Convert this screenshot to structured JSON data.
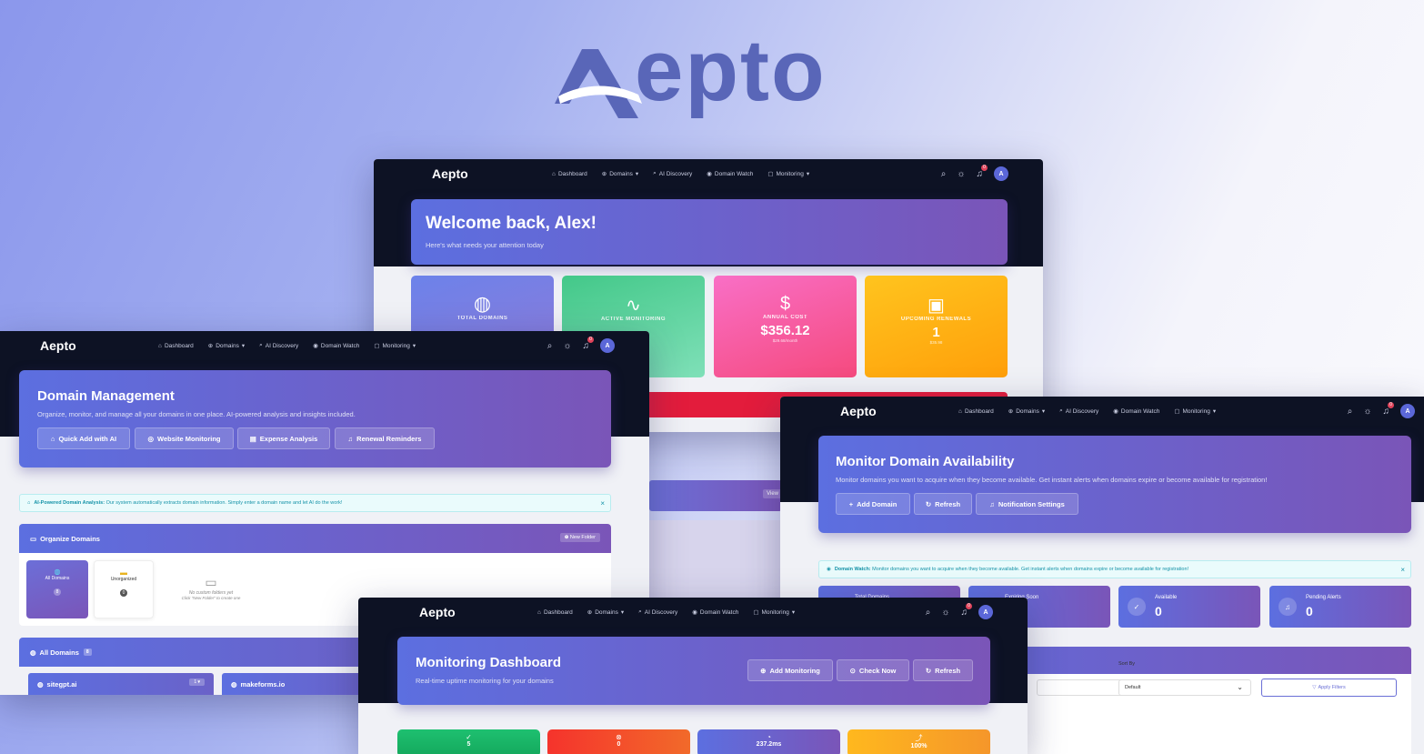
{
  "brand": {
    "logo_text": "epto",
    "full": "Aepto",
    "accent": "#5966b8"
  },
  "nav": {
    "brand": "Aepto",
    "links": [
      "Dashboard",
      "Domains",
      "AI Discovery",
      "Domain Watch",
      "Monitoring"
    ],
    "avatar": "A",
    "badge": "0"
  },
  "dashboard": {
    "title": "Welcome back, Alex!",
    "subtitle": "Here's what needs your attention today",
    "cards": [
      {
        "label": "TOTAL DOMAINS",
        "value": "",
        "sub": "",
        "color": "#6b7fe6"
      },
      {
        "label": "ACTIVE MONITORING",
        "value": "",
        "sub": "",
        "color": "#4bcf8e"
      },
      {
        "label": "ANNUAL COST",
        "value": "$356.12",
        "sub": "$29.68/month",
        "color": "#f6529b"
      },
      {
        "label": "UPCOMING RENEWALS",
        "value": "1",
        "sub": "$35.98",
        "color": "#ffb20a"
      }
    ]
  },
  "domain_mgmt": {
    "title": "Domain Management",
    "subtitle": "Organize, monitor, and manage all your domains in one place. AI-powered analysis and insights included.",
    "buttons": [
      "Quick Add with AI",
      "Website Monitoring",
      "Expense Analysis",
      "Renewal Reminders"
    ],
    "info_strong": "AI-Powered Domain Analysis:",
    "info_text": "Our system automatically extracts domain information. Simply enter a domain name and let AI do the work!",
    "organize_title": "Organize Domains",
    "new_folder": "New Folder",
    "folders": [
      {
        "name": "All Domains",
        "count": "8"
      },
      {
        "name": "Unorganized",
        "count": "0"
      }
    ],
    "empty_title": "No custom folders yet",
    "empty_hint": "Click \"New Folder\" to create one",
    "all_domains": "All Domains",
    "all_count": "8",
    "domains": [
      "sitegpt.ai",
      "makeforms.io"
    ],
    "domain_tag": "1"
  },
  "domain_watch": {
    "title": "Monitor Domain Availability",
    "subtitle": "Monitor domains you want to acquire when they become available. Get instant alerts when domains expire or become available for registration!",
    "buttons": [
      "Add Domain",
      "Refresh",
      "Notification Settings"
    ],
    "info_strong": "Domain Watch:",
    "info_text": "Monitor domains you want to acquire when they become available. Get instant alerts when domains expire or become available for registration!",
    "stats": [
      {
        "label": "Total Domains",
        "value": ""
      },
      {
        "label": "Expiring Soon",
        "value": ""
      },
      {
        "label": "Available",
        "value": "0"
      },
      {
        "label": "Pending Alerts",
        "value": "0"
      }
    ],
    "sort_label": "Sort By",
    "sort_value": "Default",
    "apply": "Apply Filters"
  },
  "monitoring": {
    "title": "Monitoring Dashboard",
    "subtitle": "Real-time uptime monitoring for your domains",
    "buttons": [
      "Add Monitoring",
      "Check Now",
      "Refresh"
    ],
    "cards": [
      {
        "value": "5",
        "color": "#1db46a"
      },
      {
        "value": "0",
        "color": "#f0412f"
      },
      {
        "value": "237.2ms",
        "color": "#6a62c8"
      },
      {
        "value": "100%",
        "color": "#f5a623"
      }
    ]
  },
  "misc": {
    "view": "View"
  }
}
